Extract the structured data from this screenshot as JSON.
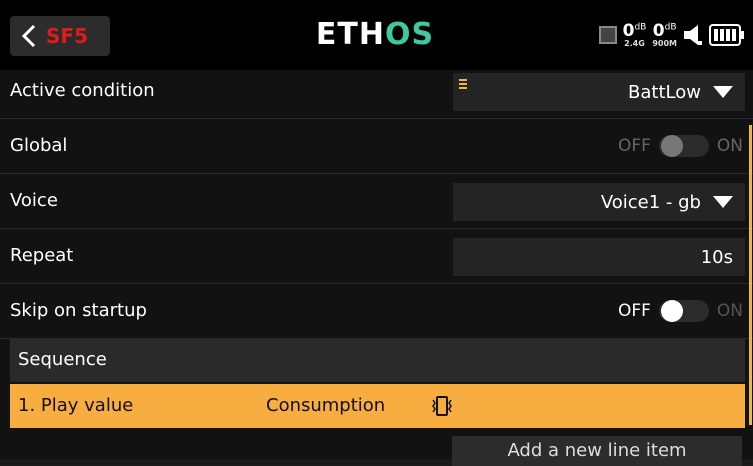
{
  "header": {
    "back_icon": "chevron-left-icon",
    "title": "SF5",
    "logo": {
      "part1": "ETH",
      "part2": "OS"
    },
    "status": {
      "rssi_24": {
        "value": "0",
        "unit": "dB",
        "band": "2.4G"
      },
      "rssi_900": {
        "value": "0",
        "unit": "dB",
        "band": "900M"
      },
      "icons": [
        "trainer-indicator-icon",
        "speaker-icon",
        "battery-icon"
      ]
    }
  },
  "rows": {
    "active_condition": {
      "label": "Active condition",
      "value": "BattLow"
    },
    "global": {
      "label": "Global",
      "off": "OFF",
      "on": "ON",
      "state": "off",
      "enabled": false
    },
    "voice": {
      "label": "Voice",
      "value": "Voice1 - gb"
    },
    "repeat": {
      "label": "Repeat",
      "value": "10s"
    },
    "skip": {
      "label": "Skip on startup",
      "off": "OFF",
      "on": "ON",
      "state": "off",
      "enabled": true
    }
  },
  "sequence": {
    "title": "Sequence",
    "items": [
      {
        "index_label": "1. Play value",
        "value": "Consumption",
        "icon": "haptic-vibrate-icon"
      }
    ],
    "add_label": "Add a new line item"
  },
  "colors": {
    "accent": "#f7ad40",
    "title_red": "#e01b1b",
    "logo_green": "#3fc9a3",
    "background": "#121212"
  }
}
